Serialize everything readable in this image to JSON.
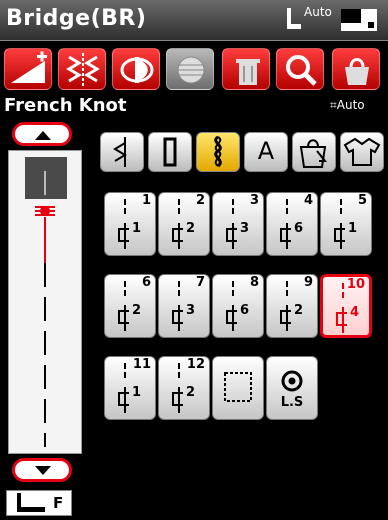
{
  "header": {
    "title": "Bridge(BR)",
    "auto_label": "Auto"
  },
  "stitch": {
    "name": "French Knot",
    "auto_label": "Auto"
  },
  "presser_foot": {
    "label": "F"
  },
  "toolbar": [
    {
      "name": "width-plus-icon"
    },
    {
      "name": "mirror-icon"
    },
    {
      "name": "half-icon"
    },
    {
      "name": "bobbin-icon"
    },
    {
      "name": "trash-icon"
    },
    {
      "name": "magnifier-icon"
    },
    {
      "name": "bag-icon"
    }
  ],
  "categories": [
    {
      "name": "utility-category-icon"
    },
    {
      "name": "buttonhole-category-icon"
    },
    {
      "name": "decorative-category-icon",
      "active": true
    },
    {
      "name": "letter-category",
      "label": "A"
    },
    {
      "name": "bag-category-icon"
    },
    {
      "name": "shirt-category-icon"
    }
  ],
  "stitches": [
    {
      "num": "1",
      "sub": "1"
    },
    {
      "num": "2",
      "sub": "2"
    },
    {
      "num": "3",
      "sub": "3"
    },
    {
      "num": "4",
      "sub": "6"
    },
    {
      "num": "5",
      "sub": "1"
    },
    {
      "num": "6",
      "sub": "2"
    },
    {
      "num": "7",
      "sub": "3"
    },
    {
      "num": "8",
      "sub": "6"
    },
    {
      "num": "9",
      "sub": "2"
    },
    {
      "num": "10",
      "sub": "4",
      "selected": true
    },
    {
      "num": "11",
      "sub": "1"
    },
    {
      "num": "12",
      "sub": "2"
    },
    {
      "name": "frame-stitch"
    },
    {
      "name": "ls-stitch",
      "label": "L.S"
    }
  ],
  "colors": {
    "accent": "#e60012",
    "active_category": "#f3c416"
  }
}
